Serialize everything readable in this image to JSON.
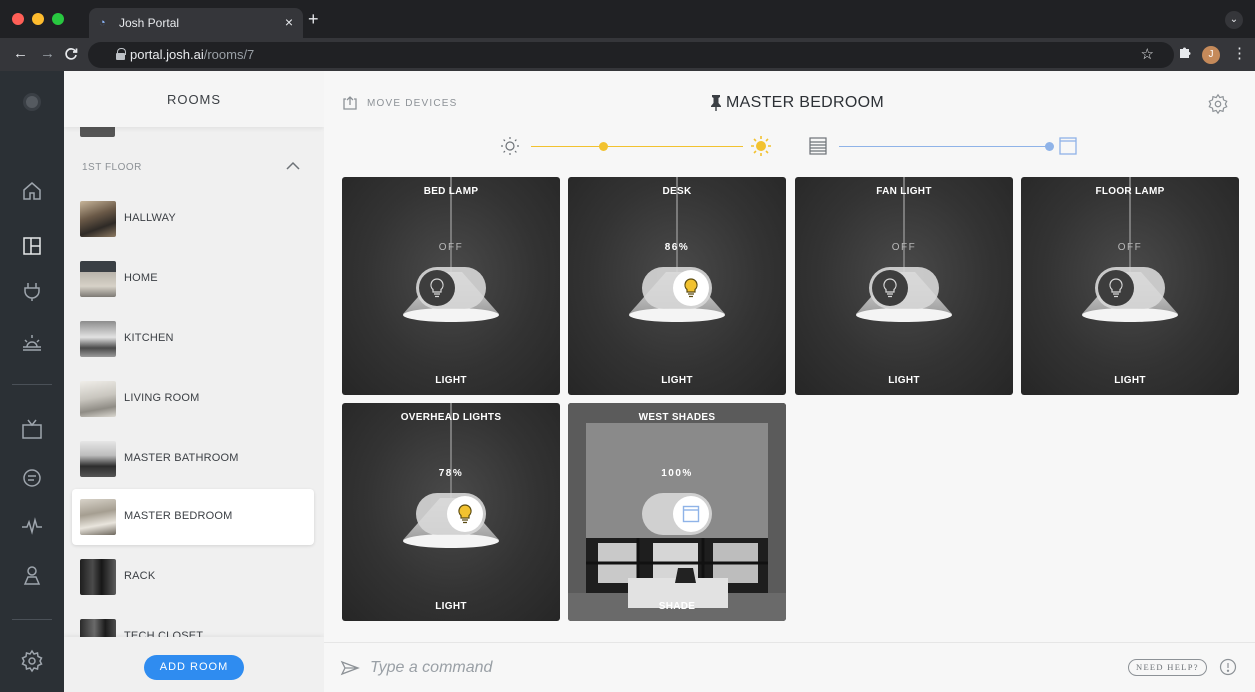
{
  "browser": {
    "tab_title": "Josh Portal",
    "tab_close": "×",
    "new_tab": "+",
    "url_host": "portal.josh.ai",
    "url_path": "/rooms/7",
    "profile_initial": "J",
    "icons": [
      "back-arrow-icon",
      "forward-arrow-icon",
      "reload-icon",
      "lock-icon",
      "star-icon",
      "puzzle-icon",
      "kebab-menu-icon"
    ]
  },
  "rail": {
    "icons": [
      "josh-logo",
      "home-icon",
      "rooms-icon",
      "plug-icon",
      "scene-icon",
      "tv-icon",
      "chat-icon",
      "activity-icon",
      "user-icon",
      "gear-icon"
    ]
  },
  "sidebar": {
    "title": "ROOMS",
    "floor_label": "1ST FLOOR",
    "rooms": [
      {
        "name": "HALLWAY"
      },
      {
        "name": "HOME"
      },
      {
        "name": "KITCHEN"
      },
      {
        "name": "LIVING ROOM"
      },
      {
        "name": "MASTER BATHROOM"
      },
      {
        "name": "MASTER BEDROOM",
        "selected": true
      },
      {
        "name": "RACK"
      },
      {
        "name": "TECH CLOSET"
      }
    ],
    "add_room_label": "ADD ROOM"
  },
  "main": {
    "move_devices_label": "MOVE DEVICES",
    "room_title": "MASTER BEDROOM",
    "light_slider_level": 0.34,
    "shade_slider_level": 1.0,
    "accent_yellow": "#f2c230",
    "accent_blue": "#8fb3e8",
    "devices": [
      {
        "name": "BED LAMP",
        "status": "OFF",
        "type": "LIGHT",
        "on": false
      },
      {
        "name": "DESK",
        "status": "86%",
        "type": "LIGHT",
        "on": true
      },
      {
        "name": "FAN LIGHT",
        "status": "OFF",
        "type": "LIGHT",
        "on": false
      },
      {
        "name": "FLOOR LAMP",
        "status": "OFF",
        "type": "LIGHT",
        "on": false
      },
      {
        "name": "OVERHEAD LIGHTS",
        "status": "78%",
        "type": "LIGHT",
        "on": true
      },
      {
        "name": "WEST SHADES",
        "status": "100%",
        "type": "SHADE",
        "on": true
      }
    ]
  },
  "command_bar": {
    "placeholder": "Type a command",
    "need_help_label": "NEED HELP?"
  }
}
